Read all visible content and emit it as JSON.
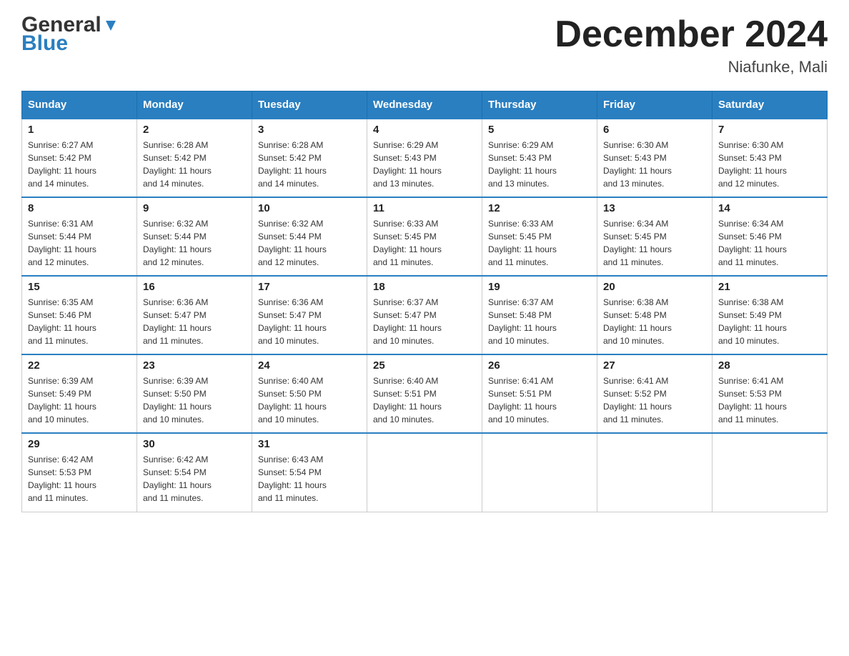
{
  "header": {
    "logo_general": "General",
    "logo_blue": "Blue",
    "month_title": "December 2024",
    "location": "Niafunke, Mali"
  },
  "days_of_week": [
    "Sunday",
    "Monday",
    "Tuesday",
    "Wednesday",
    "Thursday",
    "Friday",
    "Saturday"
  ],
  "weeks": [
    [
      {
        "day": "1",
        "sunrise": "6:27 AM",
        "sunset": "5:42 PM",
        "daylight": "11 hours and 14 minutes."
      },
      {
        "day": "2",
        "sunrise": "6:28 AM",
        "sunset": "5:42 PM",
        "daylight": "11 hours and 14 minutes."
      },
      {
        "day": "3",
        "sunrise": "6:28 AM",
        "sunset": "5:42 PM",
        "daylight": "11 hours and 14 minutes."
      },
      {
        "day": "4",
        "sunrise": "6:29 AM",
        "sunset": "5:43 PM",
        "daylight": "11 hours and 13 minutes."
      },
      {
        "day": "5",
        "sunrise": "6:29 AM",
        "sunset": "5:43 PM",
        "daylight": "11 hours and 13 minutes."
      },
      {
        "day": "6",
        "sunrise": "6:30 AM",
        "sunset": "5:43 PM",
        "daylight": "11 hours and 13 minutes."
      },
      {
        "day": "7",
        "sunrise": "6:30 AM",
        "sunset": "5:43 PM",
        "daylight": "11 hours and 12 minutes."
      }
    ],
    [
      {
        "day": "8",
        "sunrise": "6:31 AM",
        "sunset": "5:44 PM",
        "daylight": "11 hours and 12 minutes."
      },
      {
        "day": "9",
        "sunrise": "6:32 AM",
        "sunset": "5:44 PM",
        "daylight": "11 hours and 12 minutes."
      },
      {
        "day": "10",
        "sunrise": "6:32 AM",
        "sunset": "5:44 PM",
        "daylight": "11 hours and 12 minutes."
      },
      {
        "day": "11",
        "sunrise": "6:33 AM",
        "sunset": "5:45 PM",
        "daylight": "11 hours and 11 minutes."
      },
      {
        "day": "12",
        "sunrise": "6:33 AM",
        "sunset": "5:45 PM",
        "daylight": "11 hours and 11 minutes."
      },
      {
        "day": "13",
        "sunrise": "6:34 AM",
        "sunset": "5:45 PM",
        "daylight": "11 hours and 11 minutes."
      },
      {
        "day": "14",
        "sunrise": "6:34 AM",
        "sunset": "5:46 PM",
        "daylight": "11 hours and 11 minutes."
      }
    ],
    [
      {
        "day": "15",
        "sunrise": "6:35 AM",
        "sunset": "5:46 PM",
        "daylight": "11 hours and 11 minutes."
      },
      {
        "day": "16",
        "sunrise": "6:36 AM",
        "sunset": "5:47 PM",
        "daylight": "11 hours and 11 minutes."
      },
      {
        "day": "17",
        "sunrise": "6:36 AM",
        "sunset": "5:47 PM",
        "daylight": "11 hours and 10 minutes."
      },
      {
        "day": "18",
        "sunrise": "6:37 AM",
        "sunset": "5:47 PM",
        "daylight": "11 hours and 10 minutes."
      },
      {
        "day": "19",
        "sunrise": "6:37 AM",
        "sunset": "5:48 PM",
        "daylight": "11 hours and 10 minutes."
      },
      {
        "day": "20",
        "sunrise": "6:38 AM",
        "sunset": "5:48 PM",
        "daylight": "11 hours and 10 minutes."
      },
      {
        "day": "21",
        "sunrise": "6:38 AM",
        "sunset": "5:49 PM",
        "daylight": "11 hours and 10 minutes."
      }
    ],
    [
      {
        "day": "22",
        "sunrise": "6:39 AM",
        "sunset": "5:49 PM",
        "daylight": "11 hours and 10 minutes."
      },
      {
        "day": "23",
        "sunrise": "6:39 AM",
        "sunset": "5:50 PM",
        "daylight": "11 hours and 10 minutes."
      },
      {
        "day": "24",
        "sunrise": "6:40 AM",
        "sunset": "5:50 PM",
        "daylight": "11 hours and 10 minutes."
      },
      {
        "day": "25",
        "sunrise": "6:40 AM",
        "sunset": "5:51 PM",
        "daylight": "11 hours and 10 minutes."
      },
      {
        "day": "26",
        "sunrise": "6:41 AM",
        "sunset": "5:51 PM",
        "daylight": "11 hours and 10 minutes."
      },
      {
        "day": "27",
        "sunrise": "6:41 AM",
        "sunset": "5:52 PM",
        "daylight": "11 hours and 11 minutes."
      },
      {
        "day": "28",
        "sunrise": "6:41 AM",
        "sunset": "5:53 PM",
        "daylight": "11 hours and 11 minutes."
      }
    ],
    [
      {
        "day": "29",
        "sunrise": "6:42 AM",
        "sunset": "5:53 PM",
        "daylight": "11 hours and 11 minutes."
      },
      {
        "day": "30",
        "sunrise": "6:42 AM",
        "sunset": "5:54 PM",
        "daylight": "11 hours and 11 minutes."
      },
      {
        "day": "31",
        "sunrise": "6:43 AM",
        "sunset": "5:54 PM",
        "daylight": "11 hours and 11 minutes."
      },
      null,
      null,
      null,
      null
    ]
  ],
  "labels": {
    "sunrise": "Sunrise:",
    "sunset": "Sunset:",
    "daylight": "Daylight:"
  }
}
